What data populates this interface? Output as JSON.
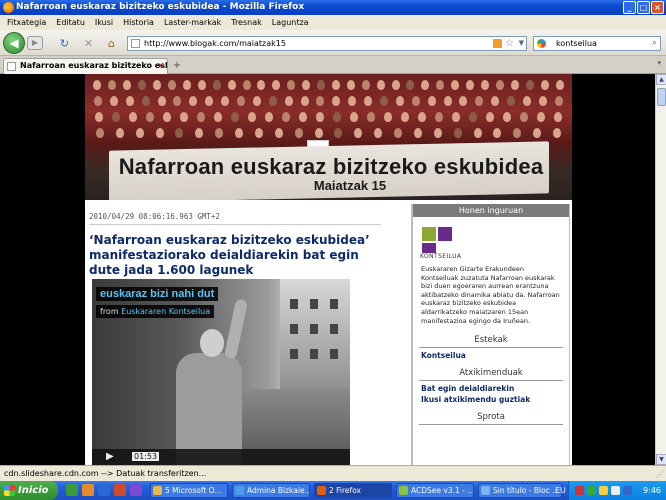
{
  "window": {
    "title": "Nafarroan euskaraz bizitzeko eskubidea - Mozilla Firefox",
    "btn_minimize": "_",
    "btn_maximize": "□",
    "btn_close": "×"
  },
  "menu": [
    "Fitxategia",
    "Editatu",
    "Ikusi",
    "Historia",
    "Laster-markak",
    "Tresnak",
    "Laguntza"
  ],
  "nav": {
    "url": "http://www.blogak.com/maiatzak15",
    "search_value": "kontseilua",
    "back_glyph": "◀",
    "forward_glyph": "▶",
    "reload_glyph": "↻",
    "stop_glyph": "✕",
    "home_glyph": "⌂"
  },
  "tabs": [
    {
      "label": "Nafarroan euskaraz bizitzeko eskubi...",
      "close": "×"
    }
  ],
  "tabbar": {
    "new_tab": "+",
    "list": "▾"
  },
  "banner": {
    "title": "Nafarroan euskaraz bizitzeko eskubidea",
    "subtitle": "Maiatzak 15"
  },
  "post": {
    "date": "2010/04/29 08:06:16.963 GMT+2",
    "title": "‘Nafarroan euskaraz bizitzeko eskubidea’ manifestaziorako deialdiarekin bat egin dute jada 1.600 lagunek"
  },
  "video": {
    "title": "euskaraz bizi nahi dut",
    "from_label": "from",
    "from_link": "Euskararen Kontseilua",
    "time": "01:53",
    "play_glyph": "▶"
  },
  "sidebar": {
    "header": "Honen inguruan",
    "logo_name": "KONTSEILUA",
    "about_text": "Euskararen Gizarte Erakundeen Kontseiluak zuzatuta Nafarroan euskarak bizi duen egoeraren aurrean erantzuna aktibatzeko dinamika abiatu da. Nafarroan euskaraz bizitzeko eskubidea aldarrikatzeko maiatzaren 15ean manifestazioa egingo da Iruñean.",
    "sections": [
      {
        "title": "Estekak",
        "links": [
          "Kontseilua"
        ]
      },
      {
        "title": "Atxikimenduak",
        "links": [
          "Bat egin deialdiarekin",
          "Ikusi atxikimendu guztiak"
        ]
      },
      {
        "title": "Sprota",
        "links": []
      }
    ]
  },
  "status": {
    "text": "cdn.slideshare.cdn.com --> Datuak transferitzen..."
  },
  "taskbar": {
    "start": "Inicio",
    "items": [
      {
        "label": "5 Microsoft O...",
        "color": "#e8b94a"
      },
      {
        "label": "Admina Bizkaie...",
        "color": "#4aa0e8"
      },
      {
        "label": "2 Firefox",
        "color": "#e06010",
        "active": true
      },
      {
        "label": "ACDSee v3.1 - ...",
        "color": "#8ac43a"
      },
      {
        "label": "Sin título - Bloc ...",
        "color": "#7ab4f0"
      }
    ],
    "lang": "EU",
    "clock": "9:46"
  }
}
